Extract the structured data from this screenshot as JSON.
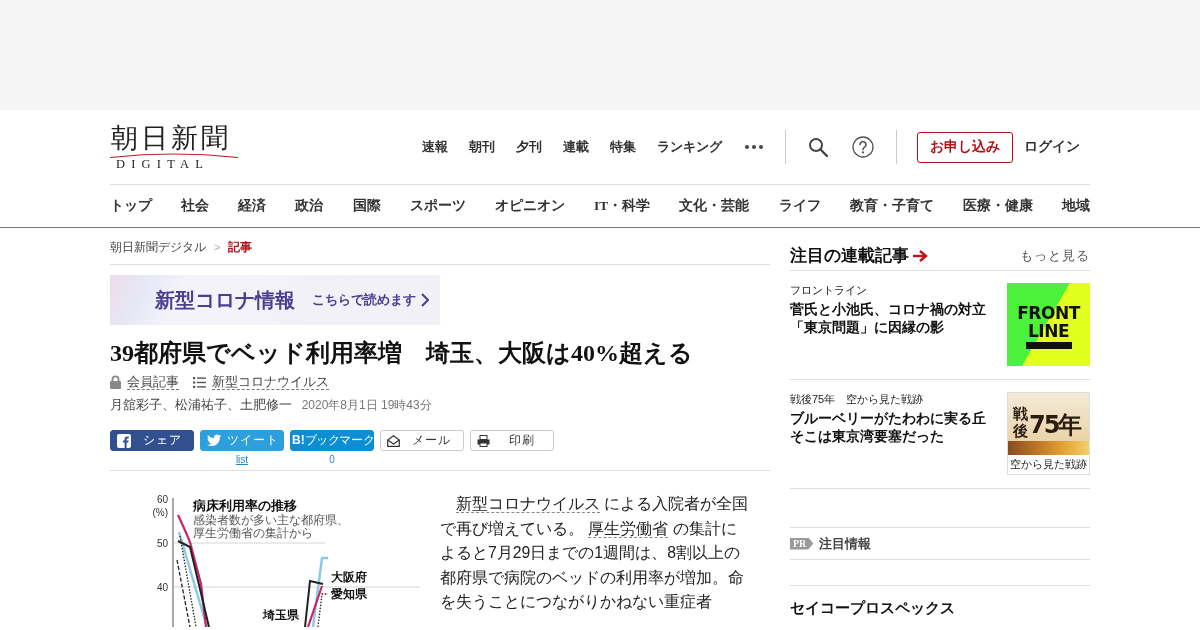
{
  "header": {
    "logo": {
      "wordmark": "朝日新聞",
      "tagline": "DIGITAL"
    },
    "nav": [
      "速報",
      "朝刊",
      "夕刊",
      "連載",
      "特集",
      "ランキング"
    ],
    "signup_button": "お申し込み",
    "login": "ログイン"
  },
  "categories": [
    "トップ",
    "社会",
    "経済",
    "政治",
    "国際",
    "スポーツ",
    "オピニオン",
    "IT・科学",
    "文化・芸能",
    "ライフ",
    "教育・子育て",
    "医療・健康",
    "地域"
  ],
  "breadcrumb": {
    "separator": ">",
    "items": [
      {
        "label": "朝日新聞デジタル",
        "current": false
      },
      {
        "label": "記事",
        "current": true
      }
    ]
  },
  "banner": {
    "title": "新型コロナ情報",
    "link": "こちらで読めます"
  },
  "article": {
    "title": "39都府県でベッド利用率増　埼玉、大阪は40%超える",
    "tags": [
      {
        "kind": "members",
        "label": "会員記事"
      },
      {
        "kind": "topic",
        "label": "新型コロナウイルス"
      }
    ],
    "authors": "月舘彩子、松浦祐子、土肥修一",
    "date": "2020年8月1日 19時43分",
    "share": [
      {
        "kind": "facebook",
        "label": "シェア"
      },
      {
        "kind": "twitter",
        "label": "ツイート",
        "count": "list"
      },
      {
        "kind": "hatena",
        "label": "**B!**ブックマーク",
        "count": "0"
      },
      {
        "kind": "mail",
        "label": "メール"
      },
      {
        "kind": "print",
        "label": "印刷"
      }
    ],
    "figure": {
      "title": "病床利用率の推移",
      "subtitle_lines": [
        "感染者数が多い主な都府県、",
        "厚生労働省の集計から"
      ],
      "unit": "(%)",
      "y_labels": [
        "60",
        "50",
        "40"
      ],
      "series_labels": [
        "大阪府",
        "愛知県",
        "埼玉県"
      ]
    },
    "body": [
      {
        "kind": "link",
        "text": "新型コロナウイルス"
      },
      {
        "kind": "text",
        "text": " による入院者が全国で再び増えている。 "
      },
      {
        "kind": "link",
        "text": "厚生労働省"
      },
      {
        "kind": "text",
        "text": " の集計によると7月29日までの1週間は、8割以上の都府県で病院のベッドの利用率が増加。命を失うことにつながりかねない重症者"
      }
    ]
  },
  "sidebar": {
    "series": {
      "title": "注目の連載記事",
      "more": "もっと見る",
      "items": [
        {
          "category": "フロントライン",
          "title": "菅氏と小池氏、コロナ禍の対立「東京問題」に因縁の影",
          "thumbnail": {
            "kind": "frontline",
            "lines": [
              "FRONT",
              "LINE"
            ]
          }
        },
        {
          "category": "戦後75年　空から見た戦跡",
          "title": "ブルーベリーがたわわに実る丘そこは東京湾要塞だった",
          "thumbnail": {
            "kind": "sengo",
            "vertical": "戦後",
            "big": "75年",
            "caption": "空から見た戦跡"
          }
        }
      ]
    },
    "pr": {
      "badge": "PR",
      "title": "注目情報"
    },
    "promo": {
      "title": "セイコープロスペックス"
    }
  }
}
